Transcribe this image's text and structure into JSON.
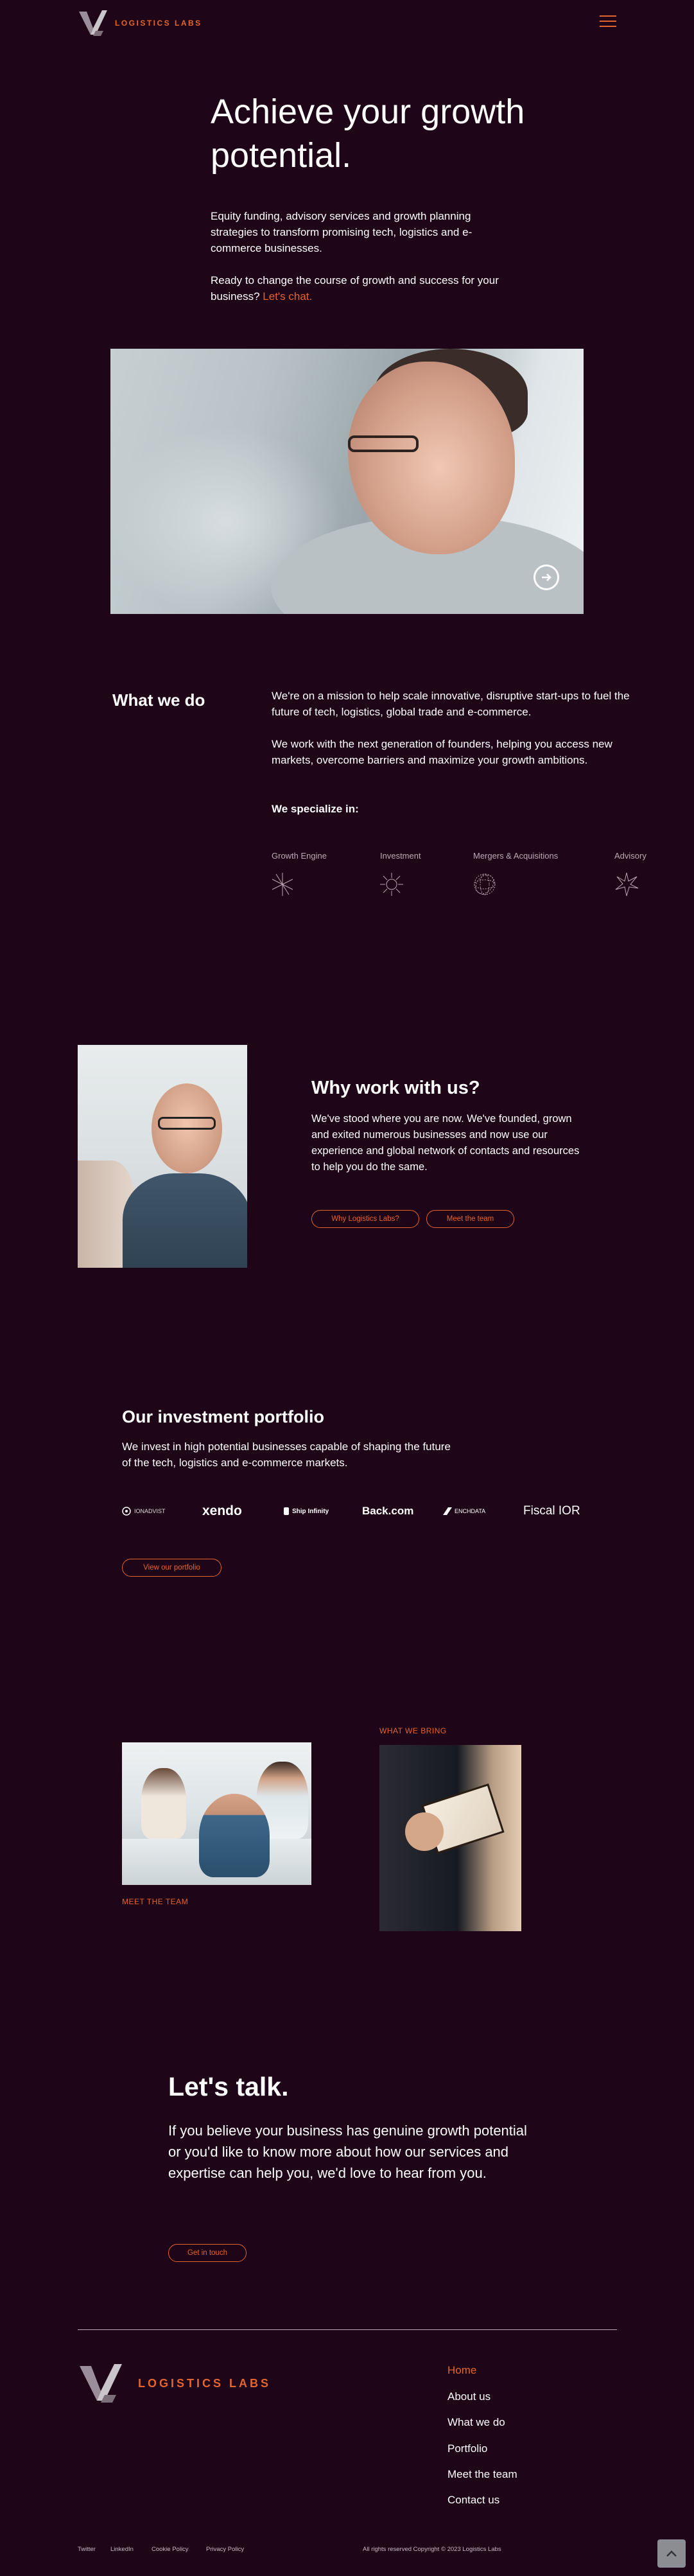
{
  "header": {
    "logo_text": "LOGISTICS LABS",
    "menu_icon": "hamburger-icon"
  },
  "hero": {
    "title": "Achieve your growth potential.",
    "paragraph": "Equity funding, advisory services and growth planning strategies to transform promising tech, logistics and e-commerce businesses.",
    "cta_text": "Ready to change the course of growth and success for your business?",
    "cta_link": "Let's chat.",
    "video_icon": "arrow-right-circle-icon"
  },
  "what_we_do": {
    "title": "What we do",
    "paragraph1": "We're on a mission to help scale innovative, disruptive start-ups to fuel the future of tech, logistics, global trade and e-commerce.",
    "paragraph2": "We work with the next generation of founders, helping you access new markets, overcome barriers and maximize your growth ambitions.",
    "specialize_label": "We specialize in:",
    "specialties": [
      {
        "label": "Growth Engine",
        "icon": "asterisk-lines-icon"
      },
      {
        "label": "Investment",
        "icon": "sunburst-icon"
      },
      {
        "label": "Mergers & Acquisitions",
        "icon": "dotted-sphere-icon"
      },
      {
        "label": "Advisory",
        "icon": "starburst-icon"
      }
    ]
  },
  "why": {
    "title": "Why work with us?",
    "paragraph": "We've stood where you are now. We've founded, grown and exited numerous businesses and now use our experience and global network of contacts and resources to help you do the same.",
    "button1": "Why Logistics Labs?",
    "button2": "Meet the team"
  },
  "portfolio": {
    "title": "Our investment portfolio",
    "paragraph": "We invest in high potential businesses capable of shaping the future of the tech, logistics and e-commerce markets.",
    "logos": [
      "IONADVIST",
      "xendo",
      "Ship Infinity",
      "Back.com",
      "ENCHDATA",
      "Fiscal IOR"
    ],
    "button": "View our portfolio"
  },
  "team": {
    "what_we_bring": "WHAT WE BRING",
    "meet_team": "MEET THE TEAM"
  },
  "talk": {
    "title": "Let's talk.",
    "paragraph": "If you believe your business has genuine growth potential or you'd like to know more about how our services and expertise can help you, we'd love to hear from you.",
    "button": "Get in touch"
  },
  "footer": {
    "logo_text": "LOGISTICS LABS",
    "nav": [
      "Home",
      "About us",
      "What we do",
      "Portfolio",
      "Meet the team",
      "Contact us"
    ],
    "links": [
      "Twitter",
      "LinkedIn",
      "Cookie Policy",
      "Privacy Policy"
    ],
    "copyright": "All rights reserved Copyright © 2023 Logistics Labs",
    "back_to_top_icon": "chevron-up-icon"
  },
  "colors": {
    "background": "#1e0517",
    "accent": "#e2652f",
    "text": "#ffffff"
  }
}
